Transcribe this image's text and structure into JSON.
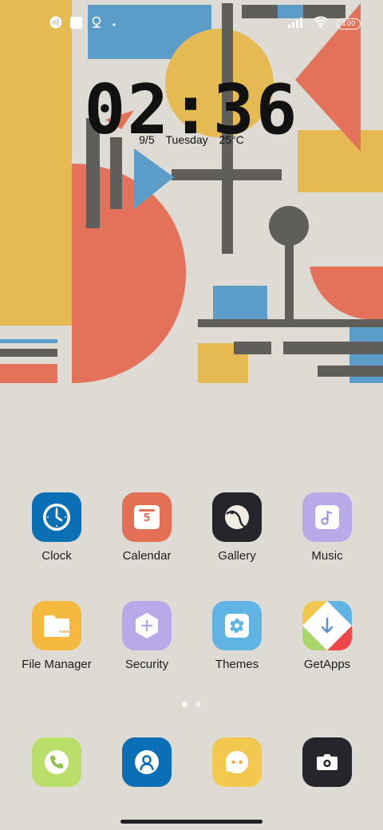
{
  "status_bar": {
    "battery": "100",
    "icons": [
      "app-icon",
      "square-icon",
      "location-icon",
      "dot-icon",
      "signal-icon",
      "wifi-icon",
      "battery-icon"
    ]
  },
  "lockclock": {
    "time": "02:36",
    "date": "9/5",
    "weekday": "Tuesday",
    "temperature": "25°C"
  },
  "apps_row1": [
    {
      "label": "Clock",
      "icon": "clock-icon",
      "color": "#0b6fb5"
    },
    {
      "label": "Calendar",
      "icon": "calendar-icon",
      "color": "#e36f55"
    },
    {
      "label": "Gallery",
      "icon": "gallery-icon",
      "color": "#24262b"
    },
    {
      "label": "Music",
      "icon": "music-icon",
      "color": "#b9a9e8"
    }
  ],
  "apps_row2": [
    {
      "label": "File Manager",
      "icon": "folder-icon",
      "color": "#f4b93e"
    },
    {
      "label": "Security",
      "icon": "security-icon",
      "color": "#b9a9e8"
    },
    {
      "label": "Themes",
      "icon": "themes-icon",
      "color": "#5fb4e3"
    },
    {
      "label": "GetApps",
      "icon": "getapps-icon",
      "color": "#ffffff"
    }
  ],
  "dock": [
    {
      "name": "phone",
      "icon": "phone-icon",
      "color": "#b9df6a"
    },
    {
      "name": "contacts",
      "icon": "contacts-icon",
      "color": "#0b6fb5"
    },
    {
      "name": "messages",
      "icon": "messages-icon",
      "color": "#f2c84f"
    },
    {
      "name": "camera",
      "icon": "camera-icon",
      "color": "#24262b"
    }
  ],
  "calendar_day": "5",
  "page_indicator": {
    "pages": 2,
    "current": 1
  }
}
